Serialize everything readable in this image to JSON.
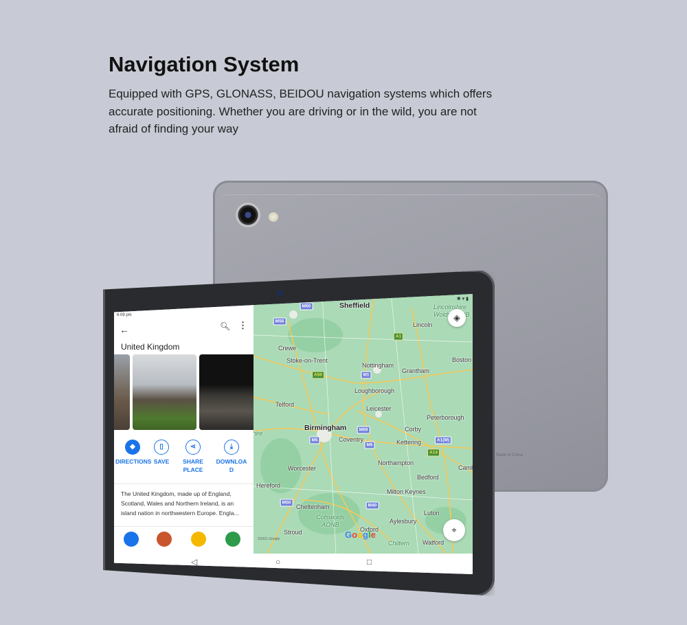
{
  "heading": {
    "title": "Navigation System",
    "description": "Equipped with GPS, GLONASS, BEIDOU navigation systems which offers accurate positioning. Whether you are driving or in the wild, you are not afraid of finding your way"
  },
  "device": {
    "back_label": "Made in China"
  },
  "screen": {
    "status_time": "6:09 pm",
    "place_title": "United Kingdom",
    "actions": [
      {
        "label": "DIRECTIONS",
        "icon": "directions-icon"
      },
      {
        "label": "SAVE",
        "icon": "bookmark-icon"
      },
      {
        "label": "SHARE PLACE",
        "icon": "share-icon"
      },
      {
        "label": "DOWNLOAD",
        "icon": "download-icon"
      }
    ],
    "about": "The United Kingdom, made up of England, Scotland, Wales and Northern Ireland, is an island nation in northwestern Europe. Engla...",
    "map": {
      "towns": [
        "Sheffield",
        "Lincoln",
        "Crewe",
        "Stoke-on-Trent",
        "Nottingham",
        "Grantham",
        "Boston",
        "Loughborough",
        "Telford",
        "Leicester",
        "Peterborough",
        "Birmingham",
        "Coventry",
        "Corby",
        "Kettering",
        "Northampton",
        "Worcester",
        "Bedford",
        "Hereford",
        "Milton Keynes",
        "Cheltenham",
        "Aylesbury",
        "Luton",
        "Oxford",
        "Stroud",
        "Watford",
        "Camb"
      ],
      "parks": [
        "Lincolnshire Wolds AONB",
        "Cotswolds AONB",
        "Chiltern",
        "Shropshire AONB"
      ],
      "roads": [
        "M60",
        "M56",
        "A1",
        "A50",
        "M1",
        "M69",
        "M6",
        "M5",
        "A1(M)",
        "A14",
        "M50",
        "M40"
      ],
      "logo": "Google",
      "copyright": "©2021 Google",
      "land_color": "#aadab6",
      "road_color": "#f5c95a"
    },
    "accent_color": "#1a73e8"
  }
}
